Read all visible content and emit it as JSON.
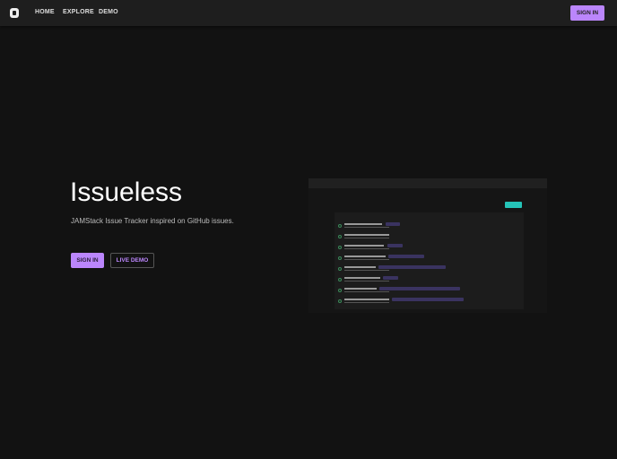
{
  "nav": {
    "home": "HOME",
    "explore": "EXPLORE",
    "demo": "DEMO",
    "sign_in": "SIGN IN"
  },
  "hero": {
    "title": "Issueless",
    "subtitle": "JAMStack Issue Tracker inspired on GitHub issues.",
    "sign_in": "SIGN IN",
    "live_demo": "LIVE DEMO"
  },
  "colors": {
    "accent": "#bb86fc",
    "background": "#121212"
  }
}
